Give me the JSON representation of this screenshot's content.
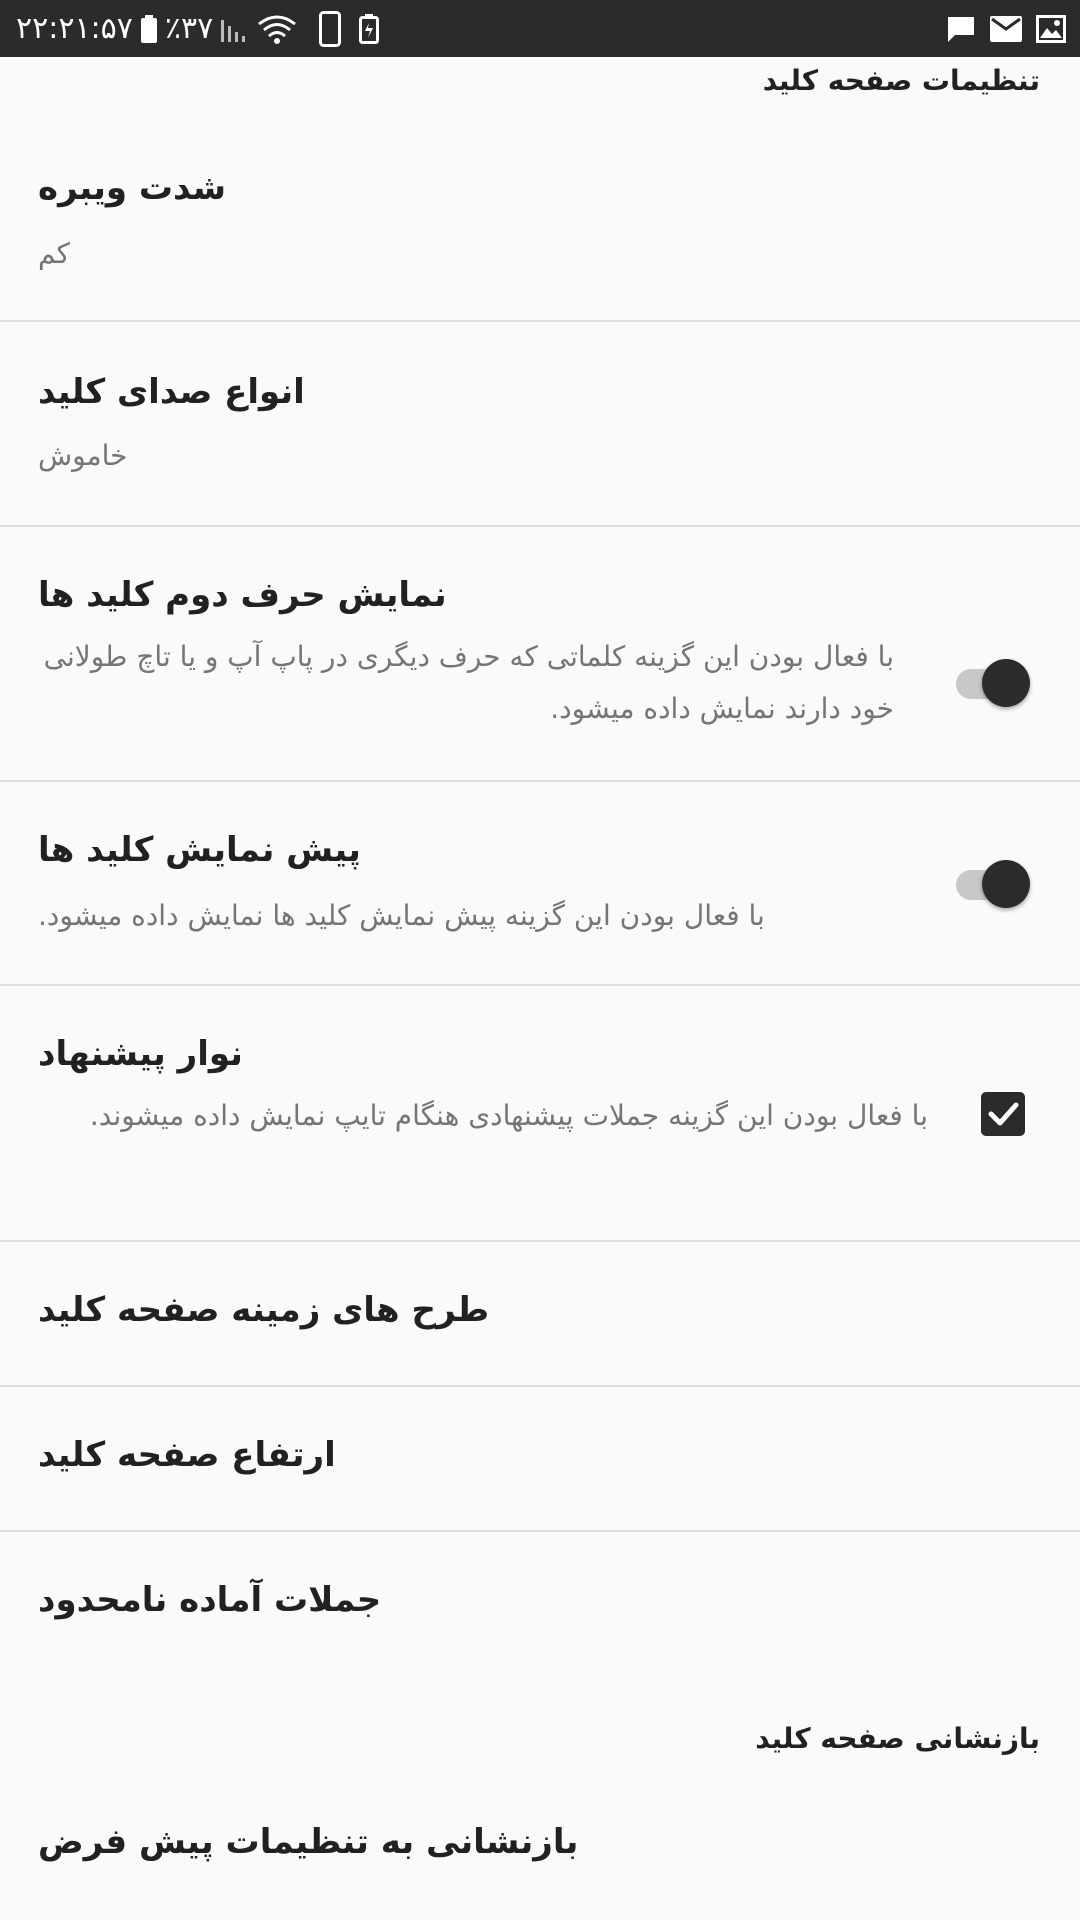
{
  "status_bar": {
    "time": "۲۲:۲۱:۵۷",
    "battery": "٪۳۷",
    "icons": [
      "battery-icon",
      "signal-icon",
      "wifi-icon",
      "phone-icon",
      "battery-saver-icon",
      "chat-icon",
      "mail-icon",
      "image-icon"
    ]
  },
  "sections": {
    "keyboard_settings": "تنظیمات صفحه کلید",
    "keyboard_reset": "بازنشانی صفحه کلید"
  },
  "prefs": {
    "vibration": {
      "title": "شدت ویبره",
      "summary": "کم"
    },
    "key_sound": {
      "title": "انواع صدای کلید",
      "summary": "خاموش"
    },
    "second_char": {
      "title": "نمایش حرف دوم کلید ها",
      "summary": "با فعال بودن این گزینه کلماتی که حرف دیگری در پاپ آپ و یا تاچ طولانی خود دارند نمایش داده میشود.",
      "enabled": true
    },
    "key_preview": {
      "title": "پیش نمایش کلید ها",
      "summary": "با فعال بودن این گزینه پیش نمایش کلید ها نمایش داده میشود.",
      "enabled": true
    },
    "suggestion_bar": {
      "title": "نوار پیشنهاد",
      "summary": "با فعال بودن این گزینه جملات پیشنهادی هنگام تایپ نمایش داده میشوند.",
      "checked": true
    },
    "themes": {
      "title": "طرح های زمینه صفحه کلید"
    },
    "height": {
      "title": "ارتفاع صفحه کلید"
    },
    "phrases": {
      "title": "جملات آماده نامحدود"
    },
    "reset_defaults": {
      "title": "بازنشانی به تنظیمات پیش فرض"
    }
  }
}
